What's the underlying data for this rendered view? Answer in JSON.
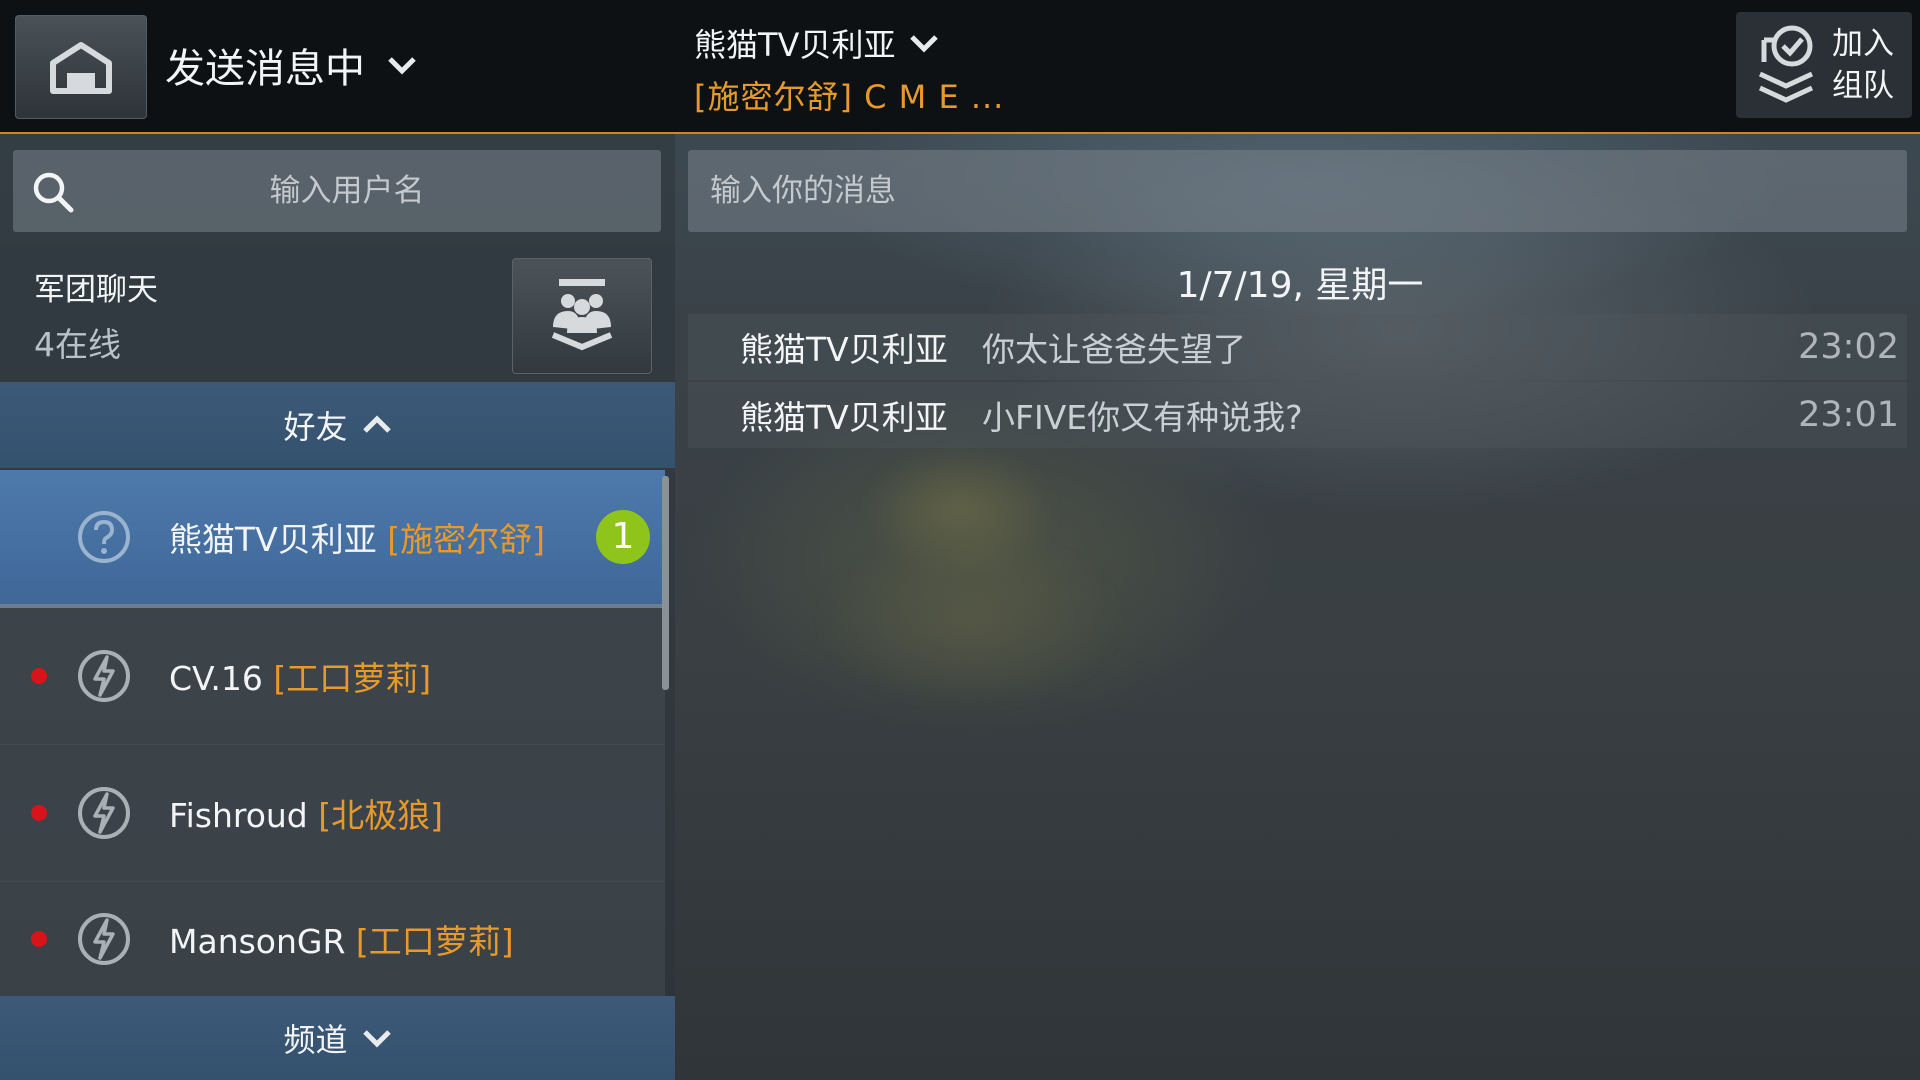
{
  "header": {
    "mode_title": "发送消息中",
    "chat_name": "熊猫TV贝利亚",
    "chat_sub": "[施密尔舒] C M E ...",
    "join_label_line1": "加入",
    "join_label_line2": "组队"
  },
  "search": {
    "placeholder": "输入用户名"
  },
  "clan_chat": {
    "title": "军团聊天",
    "online": "4在线"
  },
  "friends_section": {
    "label": "好友"
  },
  "channel_section": {
    "label": "频道"
  },
  "friends": [
    {
      "name": "熊猫TV贝利亚",
      "clan": "[施密尔舒]",
      "status": "unknown",
      "unread": "1"
    },
    {
      "name": "CV.16",
      "clan": "[工口萝莉]",
      "status": "offline"
    },
    {
      "name": "Fishroud",
      "clan": "[北极狼]",
      "status": "offline"
    },
    {
      "name": "MansonGR",
      "clan": "[工口萝莉]",
      "status": "offline"
    }
  ],
  "message_input": {
    "placeholder": "输入你的消息"
  },
  "messages": {
    "date": "1/7/19, 星期一",
    "items": [
      {
        "sender": "熊猫TV贝利亚",
        "text": "你太让爸爸失望了",
        "time": "23:02"
      },
      {
        "sender": "熊猫TV贝利亚",
        "text": "小FIVE你又有种说我?",
        "time": "23:01"
      }
    ]
  },
  "colors": {
    "accent": "#e79a2a",
    "selected": "#4670a0",
    "badge": "#8fc41a",
    "offline_dot": "#d8141a"
  }
}
